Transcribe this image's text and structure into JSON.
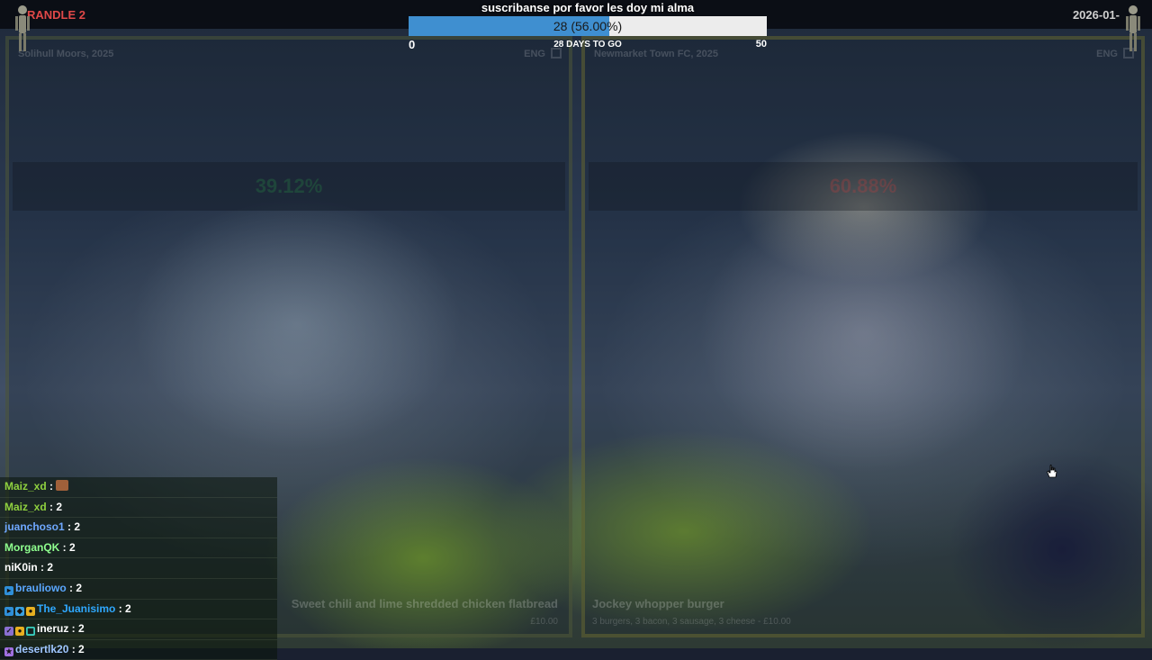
{
  "topbar": {
    "game_title": "RANDLE 2",
    "date": "2026-01-"
  },
  "goal": {
    "text": "suscribanse por favor les doy mi alma",
    "value_label": "28 (56.00%)",
    "progress": 0.56,
    "min": "0",
    "max": "50",
    "days_left": "28 DAYS TO GO",
    "colors": {
      "fill": "#3f8fd0",
      "track": "#ececec"
    }
  },
  "panels": {
    "left": {
      "club": "Solihull Moors, 2025",
      "lang": "ENG",
      "percent": "39.12%",
      "item_name": "Sweet chili and lime shredded chicken flatbread",
      "item_desc": "£10.00"
    },
    "right": {
      "club": "Newmarket Town FC, 2025",
      "lang": "ENG",
      "percent": "60.88%",
      "item_name": "Jockey whopper burger",
      "item_desc": "3 burgers, 3 bacon, 3 sausage, 3 cheese - £10.00"
    }
  },
  "chat": [
    {
      "user": "Maiz_xd",
      "msg": "",
      "color": "#8fd13f",
      "badges": [],
      "emote": true
    },
    {
      "user": "Maiz_xd",
      "msg": "2",
      "color": "#8fd13f",
      "badges": []
    },
    {
      "user": "juanchoso1",
      "msg": "2",
      "color": "#6fa8ff",
      "badges": []
    },
    {
      "user": "MorganQK",
      "msg": "2",
      "color": "#8fff8f",
      "badges": []
    },
    {
      "user": "niK0in",
      "msg": "2",
      "color": "#ffffff",
      "badges": []
    },
    {
      "user": "brauliowo",
      "msg": "2",
      "color": "#5aa7ff",
      "badges": [
        "prime"
      ]
    },
    {
      "user": "The_Juanisimo",
      "msg": "2",
      "color": "#2fa8ff",
      "badges": [
        "prime",
        "gift",
        "coin"
      ]
    },
    {
      "user": "ineruz",
      "msg": "2",
      "color": "#ffffff",
      "badges": [
        "mod",
        "coin",
        "grid"
      ]
    },
    {
      "user": "desertlk20",
      "msg": "2",
      "color": "#9fc6ff",
      "badges": [
        "sub"
      ]
    }
  ],
  "icons": {
    "cursor": "hand-pointer-icon",
    "figures": "android-figure-icon"
  }
}
